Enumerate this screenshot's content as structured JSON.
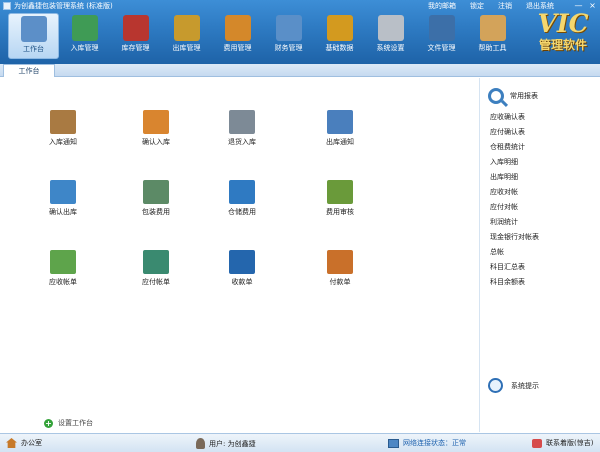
{
  "window": {
    "title": "为创鑫捷包装管理系统 (标准版)",
    "links": [
      "我的邮箱",
      "锁定",
      "注销",
      "退出系统"
    ],
    "controls": [
      "—",
      "×"
    ]
  },
  "toolbar": [
    {
      "label": "工作台",
      "icon": "desk-icon",
      "color": "#5c8fc8",
      "active": true
    },
    {
      "label": "入库管理",
      "icon": "inbound-icon",
      "color": "#3f9b55"
    },
    {
      "label": "库存管理",
      "icon": "warehouse-icon",
      "color": "#b8362f"
    },
    {
      "label": "出库管理",
      "icon": "outbound-icon",
      "color": "#c79a2d"
    },
    {
      "label": "费用管理",
      "icon": "expense-icon",
      "color": "#d4882a"
    },
    {
      "label": "财务管理",
      "icon": "finance-icon",
      "color": "#5a8fc8"
    },
    {
      "label": "基础数据",
      "icon": "base-data-icon",
      "color": "#d39a1f"
    },
    {
      "label": "系统设置",
      "icon": "settings-icon",
      "color": "#b9bfc7"
    },
    {
      "label": "文件管理",
      "icon": "files-icon",
      "color": "#3c6fa8"
    },
    {
      "label": "帮助工具",
      "icon": "help-tools-icon",
      "color": "#d3a35a"
    }
  ],
  "brand": {
    "big": "VIC",
    "small": "管理软件"
  },
  "tab": {
    "label": "工作台"
  },
  "grid": [
    {
      "label": "入库通知",
      "icon": "inbound-notice-icon",
      "color": "#a97a42"
    },
    {
      "label": "确认入库",
      "icon": "confirm-inbound-icon",
      "color": "#d9852f"
    },
    {
      "label": "退货入库",
      "icon": "return-inbound-icon",
      "color": "#7d8a96"
    },
    {
      "label": "出库通知",
      "icon": "outbound-notice-icon",
      "color": "#4a7fbd"
    },
    {
      "label": "确认出库",
      "icon": "confirm-outbound-icon",
      "color": "#3e86c8"
    },
    {
      "label": "包装费用",
      "icon": "packing-fee-icon",
      "color": "#5c8a66"
    },
    {
      "label": "仓储费用",
      "icon": "storage-fee-icon",
      "color": "#2f7ac2"
    },
    {
      "label": "费用审核",
      "icon": "fee-audit-icon",
      "color": "#6a9a3a"
    },
    {
      "label": "应收帐单",
      "icon": "receivable-icon",
      "color": "#5ea44b"
    },
    {
      "label": "应付帐单",
      "icon": "payable-icon",
      "color": "#3a8a70"
    },
    {
      "label": "收款单",
      "icon": "receipt-icon",
      "color": "#2466ad"
    },
    {
      "label": "付款单",
      "icon": "payment-icon",
      "color": "#c9702a"
    }
  ],
  "settings_link": "设置工作台",
  "reports": {
    "title": "常用报表",
    "items": [
      "应收确认表",
      "应付确认表",
      "仓租费统计",
      "入库明细",
      "出库明细",
      "应收对帐",
      "应付对帐",
      "利润统计",
      "现金银行对帐表",
      "总帐",
      "科目汇总表",
      "科目余额表"
    ]
  },
  "system_tip": "系统提示",
  "status": {
    "office": "办公室",
    "user": "用户: 为创鑫捷",
    "network": "网络连接状态：正常",
    "contact": "联系着版(惊吉)"
  }
}
